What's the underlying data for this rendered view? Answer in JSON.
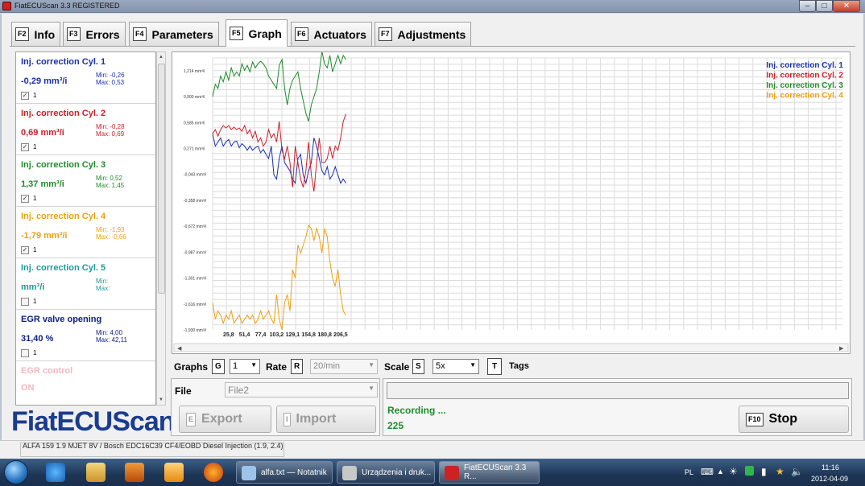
{
  "window": {
    "title": "FiatECUScan 3.3 REGISTERED"
  },
  "tabs": [
    {
      "key": "F2",
      "label": "Info"
    },
    {
      "key": "F3",
      "label": "Errors"
    },
    {
      "key": "F4",
      "label": "Parameters"
    },
    {
      "key": "F5",
      "label": "Graph",
      "active": true
    },
    {
      "key": "F6",
      "label": "Actuators"
    },
    {
      "key": "F7",
      "label": "Adjustments"
    }
  ],
  "parameters": [
    {
      "name": "Inj. correction Cyl. 1",
      "value": "-0,29 mm³/i",
      "min": "Min: -0,26",
      "max": "Max: 0,53",
      "checked": true,
      "num": "1",
      "color": "#1a2fb4"
    },
    {
      "name": "Inj. correction Cyl. 2",
      "value": "0,69 mm³/i",
      "min": "Min: -0,28",
      "max": "Max: 0,69",
      "checked": true,
      "num": "1",
      "color": "#d2202a"
    },
    {
      "name": "Inj. correction Cyl. 3",
      "value": "1,37 mm³/i",
      "min": "Min: 0,52",
      "max": "Max: 1,45",
      "checked": true,
      "num": "1",
      "color": "#1e8c2a"
    },
    {
      "name": "Inj. correction Cyl. 4",
      "value": "-1,79 mm³/i",
      "min": "Min: -1,93",
      "max": "Max: -0,66",
      "checked": true,
      "num": "1",
      "color": "#f0a010"
    },
    {
      "name": "Inj. correction Cyl. 5",
      "value": "mm³/i",
      "min": "Min:",
      "max": "Max:",
      "checked": false,
      "num": "1",
      "color": "#1e9a9a"
    },
    {
      "name": "EGR valve opening",
      "value": "31,40 %",
      "min": "Min: 4,00",
      "max": "Max: 42,11",
      "checked": false,
      "num": "1",
      "color": "#102080"
    }
  ],
  "egr_control": {
    "name": "EGR control",
    "value": "ON",
    "color": "#f2b8c0"
  },
  "logo": "FiatECUScan",
  "chart_data": {
    "type": "line",
    "x": [
      0,
      4.3,
      8.6,
      12.9,
      17.2,
      21.5,
      25.8,
      30.1,
      34.4,
      38.7,
      43,
      47.3,
      51.6,
      55.9,
      60.2,
      64.5,
      68.8,
      73.1,
      77.4,
      81.7,
      86,
      90.3,
      94.6,
      98.9,
      103.2,
      107.5,
      111.8,
      116.1,
      120.4,
      124.7,
      129,
      133.3,
      137.6,
      141.9,
      146.2,
      150.5,
      154.8,
      159.1,
      163.4,
      167.7,
      172,
      176.3,
      180.6,
      184.9,
      189.2,
      193.5,
      197.8,
      202.1,
      206.4,
      210.7,
      215
    ],
    "y_ticks": [
      "1,214 mm³/i",
      "0,900 mm³/i",
      "0,585 mm³/i",
      "0,271 mm³/i",
      "-0,043 mm³/i",
      "-0,358 mm³/i",
      "-0,672 mm³/i",
      "-0,987 mm³/i",
      "-1,301 mm³/i",
      "-1,616 mm³/i",
      "-1,930 mm³/i"
    ],
    "x_ticks": [
      "25,8",
      "51,4",
      "77,4",
      "103,2",
      "129,1",
      "154,8",
      "180,8",
      "206,5"
    ],
    "ylim": [
      -1.93,
      1.37
    ],
    "xlim": [
      0,
      1016
    ],
    "grid": true,
    "legend": "top-right",
    "series": [
      {
        "name": "Inj. correction Cyl. 1",
        "color": "#1a2fb4",
        "values": [
          0.45,
          0.3,
          0.35,
          0.4,
          0.3,
          0.35,
          0.38,
          0.3,
          0.35,
          0.36,
          0.28,
          0.33,
          0.3,
          0.25,
          0.3,
          0.25,
          0.28,
          0.3,
          0.22,
          0.26,
          0.2,
          0.15,
          0.3,
          -0.05,
          -0.1,
          0.15,
          0.3,
          0.1,
          0.05,
          0.0,
          -0.1,
          -0.15,
          0.15,
          0.2,
          -0.05,
          -0.15,
          0.0,
          0.1,
          0.4,
          0.3,
          0.15,
          0.0,
          -0.05,
          0.05,
          -0.1,
          -0.05,
          0.05,
          -0.05,
          -0.15,
          -0.1,
          -0.15
        ]
      },
      {
        "name": "Inj. correction Cyl. 2",
        "color": "#d2202a",
        "values": [
          0.45,
          0.5,
          0.42,
          0.5,
          0.55,
          0.52,
          0.55,
          0.5,
          0.53,
          0.5,
          0.52,
          0.48,
          0.55,
          0.45,
          0.5,
          0.4,
          0.48,
          0.35,
          0.4,
          0.3,
          0.35,
          0.5,
          0.4,
          0.45,
          0.35,
          0.6,
          0.25,
          0.15,
          0.3,
          0.1,
          -0.2,
          0.3,
          0.1,
          -0.1,
          -0.2,
          0.0,
          0.35,
          -0.05,
          -0.25,
          0.1,
          0.4,
          0.1,
          0.1,
          0.15,
          0.3,
          0.15,
          0.3,
          0.25,
          0.4,
          0.6,
          0.69
        ]
      },
      {
        "name": "Inj. correction Cyl. 3",
        "color": "#1e8c2a",
        "values": [
          0.9,
          1.05,
          1.0,
          1.15,
          1.08,
          1.2,
          1.1,
          1.25,
          1.15,
          1.2,
          1.15,
          1.3,
          1.22,
          1.28,
          1.2,
          1.32,
          1.25,
          1.3,
          1.33,
          1.3,
          1.25,
          1.15,
          1.1,
          1.05,
          1.0,
          1.28,
          1.35,
          1.0,
          0.8,
          1.0,
          1.1,
          1.15,
          1.2,
          1.0,
          0.85,
          0.7,
          0.6,
          0.8,
          0.9,
          1.0,
          1.2,
          1.45,
          1.3,
          1.25,
          1.4,
          1.2,
          1.3,
          1.4,
          1.3,
          1.4,
          1.35
        ]
      },
      {
        "name": "Inj. correction Cyl. 4",
        "color": "#f0a010",
        "values": [
          -1.6,
          -1.8,
          -1.7,
          -1.75,
          -1.85,
          -1.75,
          -1.8,
          -1.7,
          -1.85,
          -1.8,
          -1.75,
          -1.85,
          -1.8,
          -1.75,
          -1.8,
          -1.75,
          -1.85,
          -1.8,
          -1.7,
          -1.8,
          -1.75,
          -1.7,
          -1.8,
          -1.85,
          -1.5,
          -1.8,
          -1.93,
          -1.6,
          -1.5,
          -1.7,
          -1.2,
          -1.3,
          -0.9,
          -1.0,
          -0.9,
          -0.8,
          -0.66,
          -0.7,
          -0.85,
          -0.7,
          -0.8,
          -1.0,
          -0.7,
          -0.8,
          -1.1,
          -1.3,
          -1.4,
          -1.2,
          -1.5,
          -1.7,
          -1.75
        ]
      }
    ]
  },
  "controls": {
    "graphs_label": "Graphs",
    "graphs_key": "G",
    "graphs_value": "1",
    "rate_label": "Rate",
    "rate_key": "R",
    "rate_value": "20/min",
    "scale_label": "Scale",
    "scale_key": "S",
    "scale_value": "5x",
    "tags_key": "T",
    "tags_label": "Tags",
    "file_label": "File",
    "file_value": "File2",
    "export_key": "E",
    "export_label": "Export",
    "import_key": "I",
    "import_label": "Import",
    "recording_text": "Recording ...",
    "recording_count": "225",
    "stop_key": "F10",
    "stop_label": "Stop"
  },
  "status_bar": "ALFA 159 1.9 MJET 8V / Bosch EDC16C39 CF4/EOBD Diesel Injection (1.9, 2.4)",
  "taskbar": {
    "tasks": [
      {
        "label": "alfa.txt — Notatnik"
      },
      {
        "label": "Urządzenia i druk..."
      },
      {
        "label": "FiatECUScan 3.3 R..."
      }
    ],
    "lang": "PL",
    "time": "11:16",
    "date": "2012-04-09"
  }
}
